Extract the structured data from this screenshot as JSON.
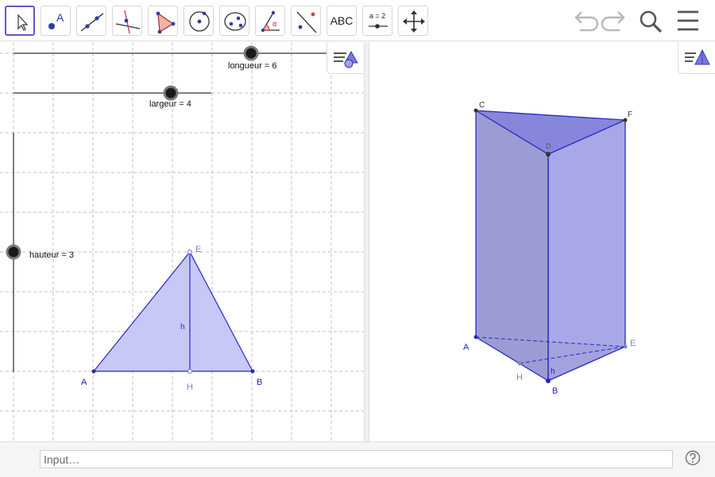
{
  "toolbar": {
    "text_tool_label": "ABC",
    "slider_tool_label": "a = 2",
    "tools": [
      {
        "name": "move-tool",
        "icon": "arrow-cursor-icon"
      },
      {
        "name": "point-tool",
        "icon": "point-icon",
        "label": "A"
      },
      {
        "name": "line-tool",
        "icon": "line-icon"
      },
      {
        "name": "perpendicular-line-tool",
        "icon": "perpendicular-icon"
      },
      {
        "name": "polygon-tool",
        "icon": "polygon-icon"
      },
      {
        "name": "circle-tool",
        "icon": "circle-center-point-icon"
      },
      {
        "name": "ellipse-tool",
        "icon": "ellipse-icon"
      },
      {
        "name": "angle-tool",
        "icon": "angle-icon",
        "label": "α"
      },
      {
        "name": "reflect-tool",
        "icon": "reflect-icon"
      },
      {
        "name": "text-tool",
        "icon": "text-icon"
      },
      {
        "name": "slider-tool",
        "icon": "slider-icon"
      },
      {
        "name": "move-graphics-view-tool",
        "icon": "move-view-icon"
      }
    ],
    "right": [
      "undo-icon",
      "redo-icon",
      "search-icon",
      "menu-icon"
    ]
  },
  "graphics2d": {
    "sliders": {
      "longueur": "longueur = 6",
      "largeur": "largeur = 4",
      "hauteur": "hauteur = 3"
    },
    "points": {
      "A": "A",
      "B": "B",
      "E": "E",
      "H": "H"
    },
    "height_label": "h"
  },
  "graphics3d": {
    "points": {
      "A": "A",
      "B": "B",
      "C": "C",
      "D": "D",
      "E": "E",
      "F": "F",
      "H": "H"
    },
    "height_label": "h"
  },
  "input_bar": {
    "placeholder": "Input…"
  },
  "colors": {
    "accent": "#6557d2",
    "polygon_fill": "#c8c8f7",
    "polygon_stroke": "#2525c8",
    "prism_front": "#a8a8e8",
    "prism_left": "#9c9cd4",
    "prism_top": "#8686dc",
    "point_label": "#1f1fbf",
    "grid": "#c0c0c0"
  }
}
